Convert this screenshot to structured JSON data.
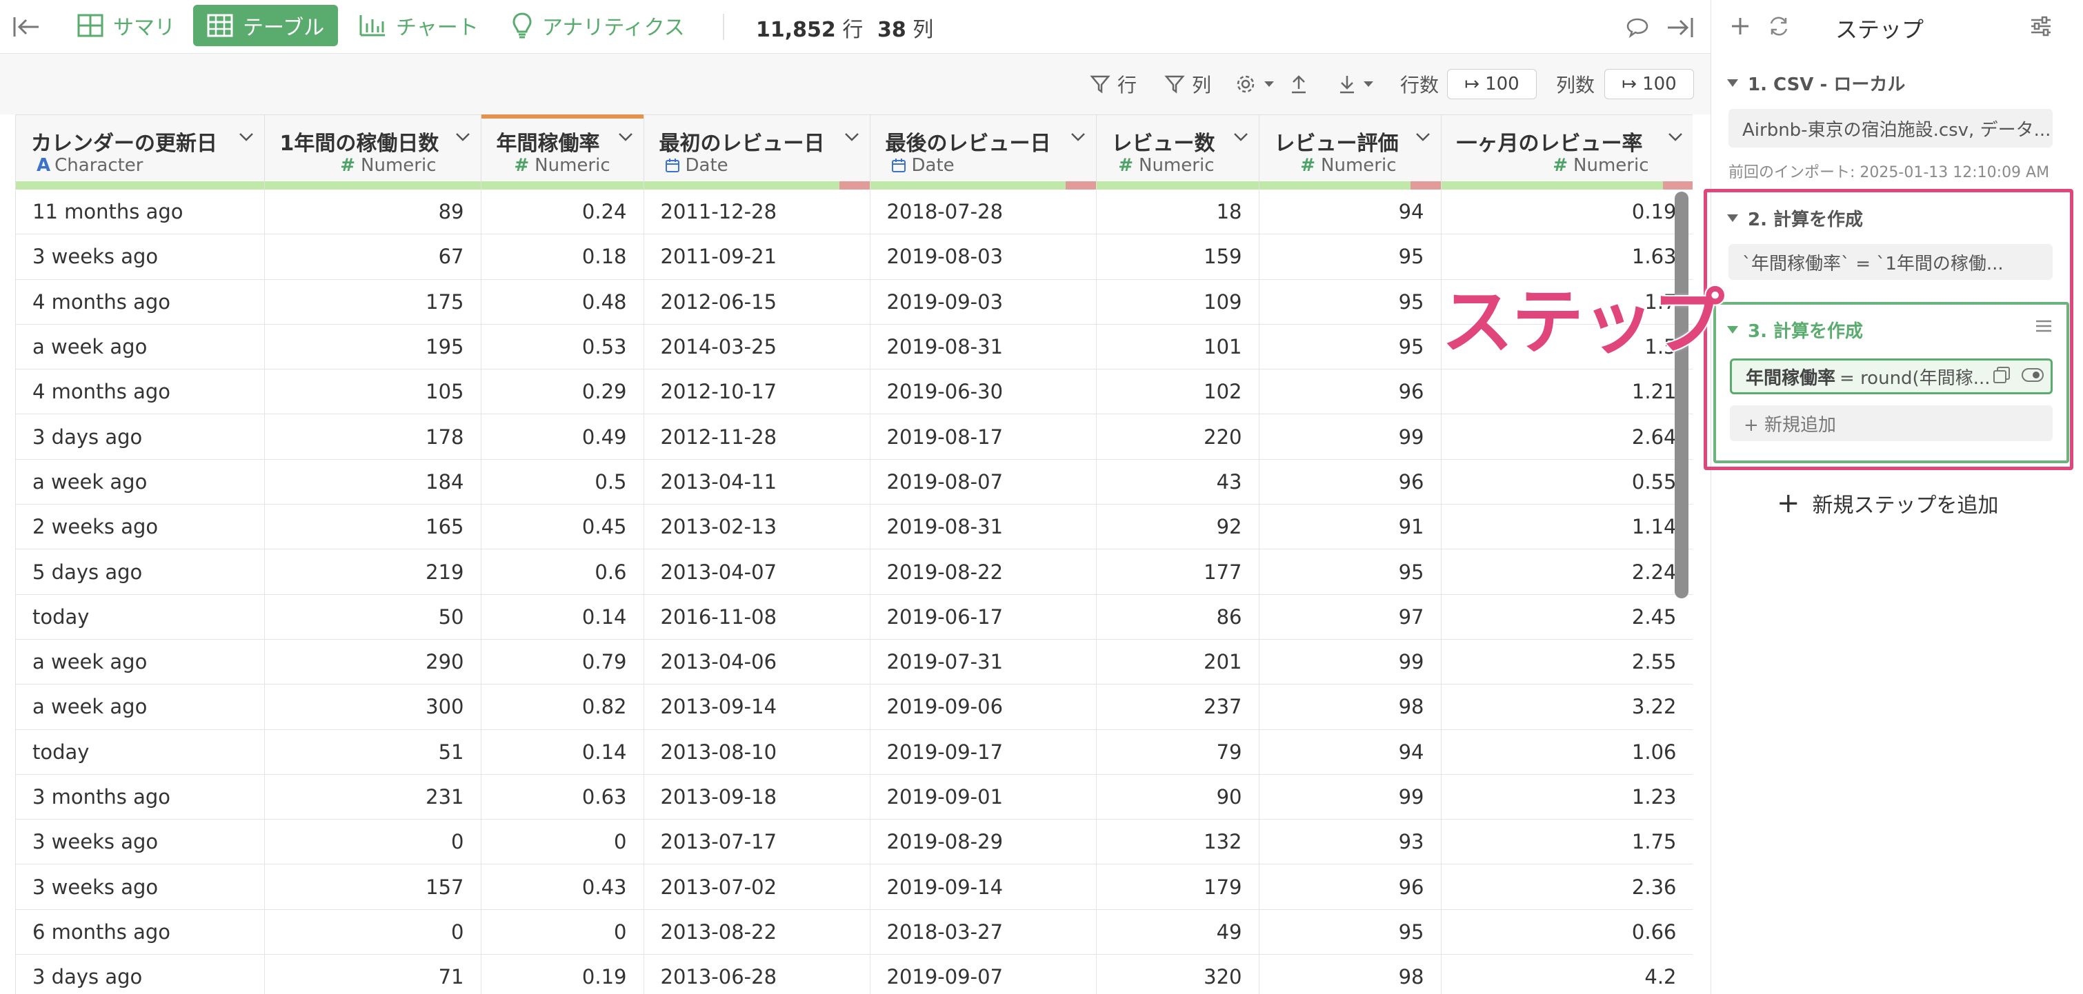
{
  "toolbar": {
    "tabs": [
      {
        "label": "サマリ",
        "icon": "summary-grid-icon"
      },
      {
        "label": "テーブル",
        "icon": "table-icon",
        "active": true
      },
      {
        "label": "チャート",
        "icon": "bar-chart-icon"
      },
      {
        "label": "アナリティクス",
        "icon": "lightbulb-icon"
      }
    ],
    "rows_value": "11,852",
    "rows_unit": "行",
    "cols_value": "38",
    "cols_unit": "列",
    "accent_color": "#5aab6e"
  },
  "subbar": {
    "row_filter": "行",
    "col_filter": "列",
    "rows_label": "行数",
    "rows_value": "100",
    "cols_label": "列数",
    "cols_value": "100"
  },
  "table": {
    "columns": [
      {
        "name": "カレンダーの更新日",
        "type": "Character"
      },
      {
        "name": "1年間の稼働日数",
        "type": "Numeric"
      },
      {
        "name": "年間稼働率",
        "type": "Numeric"
      },
      {
        "name": "最初のレビュー日",
        "type": "Date"
      },
      {
        "name": "最後のレビュー日",
        "type": "Date"
      },
      {
        "name": "レビュー数",
        "type": "Numeric"
      },
      {
        "name": "レビュー評価",
        "type": "Numeric"
      },
      {
        "name": "一ヶ月のレビュー率",
        "type": "Numeric"
      }
    ],
    "rows": [
      [
        "11 months ago",
        "89",
        "0.24",
        "2011-12-28",
        "2018-07-28",
        "18",
        "94",
        "0.19"
      ],
      [
        "3 weeks ago",
        "67",
        "0.18",
        "2011-09-21",
        "2019-08-03",
        "159",
        "95",
        "1.63"
      ],
      [
        "4 months ago",
        "175",
        "0.48",
        "2012-06-15",
        "2019-09-03",
        "109",
        "95",
        "1.7"
      ],
      [
        "a week ago",
        "195",
        "0.53",
        "2014-03-25",
        "2019-08-31",
        "101",
        "95",
        "1.5"
      ],
      [
        "4 months ago",
        "105",
        "0.29",
        "2012-10-17",
        "2019-06-30",
        "102",
        "96",
        "1.21"
      ],
      [
        "3 days ago",
        "178",
        "0.49",
        "2012-11-28",
        "2019-08-17",
        "220",
        "99",
        "2.64"
      ],
      [
        "a week ago",
        "184",
        "0.5",
        "2013-04-11",
        "2019-08-07",
        "43",
        "96",
        "0.55"
      ],
      [
        "2 weeks ago",
        "165",
        "0.45",
        "2013-02-13",
        "2019-08-31",
        "92",
        "91",
        "1.14"
      ],
      [
        "5 days ago",
        "219",
        "0.6",
        "2013-04-07",
        "2019-08-22",
        "177",
        "95",
        "2.24"
      ],
      [
        "today",
        "50",
        "0.14",
        "2016-11-08",
        "2019-06-17",
        "86",
        "97",
        "2.45"
      ],
      [
        "a week ago",
        "290",
        "0.79",
        "2013-04-06",
        "2019-07-31",
        "201",
        "99",
        "2.55"
      ],
      [
        "a week ago",
        "300",
        "0.82",
        "2013-09-14",
        "2019-09-06",
        "237",
        "98",
        "3.22"
      ],
      [
        "today",
        "51",
        "0.14",
        "2013-08-10",
        "2019-09-17",
        "79",
        "94",
        "1.06"
      ],
      [
        "3 months ago",
        "231",
        "0.63",
        "2013-09-18",
        "2019-09-01",
        "90",
        "99",
        "1.23"
      ],
      [
        "3 weeks ago",
        "0",
        "0",
        "2013-07-17",
        "2019-08-29",
        "132",
        "93",
        "1.75"
      ],
      [
        "3 weeks ago",
        "157",
        "0.43",
        "2013-07-02",
        "2019-09-14",
        "179",
        "96",
        "2.36"
      ],
      [
        "6 months ago",
        "0",
        "0",
        "2013-08-22",
        "2018-03-27",
        "49",
        "95",
        "0.66"
      ],
      [
        "3 days ago",
        "71",
        "0.19",
        "2013-06-28",
        "2019-09-07",
        "320",
        "98",
        "4.2"
      ]
    ]
  },
  "panel": {
    "title": "ステップ",
    "steps": [
      {
        "title": "1. CSV - ローカル",
        "content": "Airbnb-東京の宿泊施設.csv, データ...",
        "note": "前回のインポート: 2025-01-13 12:10:09 AM"
      },
      {
        "title": "2. 計算を作成",
        "content": "`年間稼働率` = `1年間の稼働..."
      },
      {
        "title": "3. 計算を作成",
        "content_name": "年間稼働率",
        "content_expr": "= round(年間稼...",
        "add_label": "+ 新規追加"
      }
    ],
    "add_step": "新規ステップを追加",
    "callout": "ステップ",
    "highlight_color": "#e0467c"
  }
}
